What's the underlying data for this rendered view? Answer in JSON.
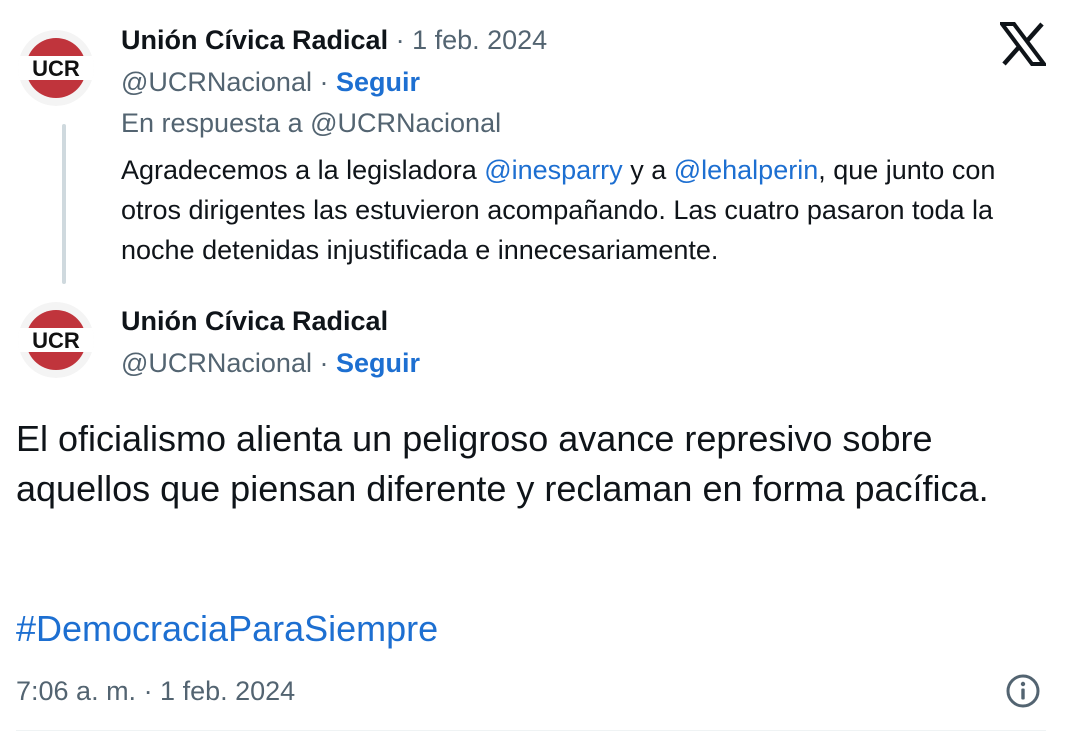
{
  "reply_tweet": {
    "author_name": "Unión Cívica Radical",
    "separator": " · ",
    "date": "1 feb. 2024",
    "handle": "@UCRNacional",
    "follow_label": "Seguir",
    "reply_to_prefix": "En respuesta a ",
    "reply_to_handle": "@UCRNacional",
    "text_part1": "Agradecemos a la legisladora ",
    "mention1": "@inesparry",
    "text_part2": " y a ",
    "mention2": "@lehalperin",
    "text_part3": ", que junto con otros dirigentes las estuvieron acompañando. Las cuatro pasaron toda la noche detenidas injustificada e innecesariamente.",
    "avatar_text": "UCR"
  },
  "main_tweet": {
    "author_name": "Unión Cívica Radical",
    "handle": "@UCRNacional",
    "separator": " · ",
    "follow_label": "Seguir",
    "avatar_text": "UCR",
    "text": "El oficialismo alienta un peligroso avance represivo sobre aquellos que piensan diferente y reclaman en forma pacífica.",
    "hashtag": "#DemocraciaParaSiempre",
    "timestamp": "7:06 a. m. · 1 feb. 2024"
  },
  "icons": {
    "platform_logo": "x-logo-icon",
    "info": "info-icon"
  },
  "colors": {
    "link": "#1d6fd1",
    "secondary_text": "#536471",
    "thread_line": "#cfd9de",
    "avatar_red": "#c0343c"
  }
}
